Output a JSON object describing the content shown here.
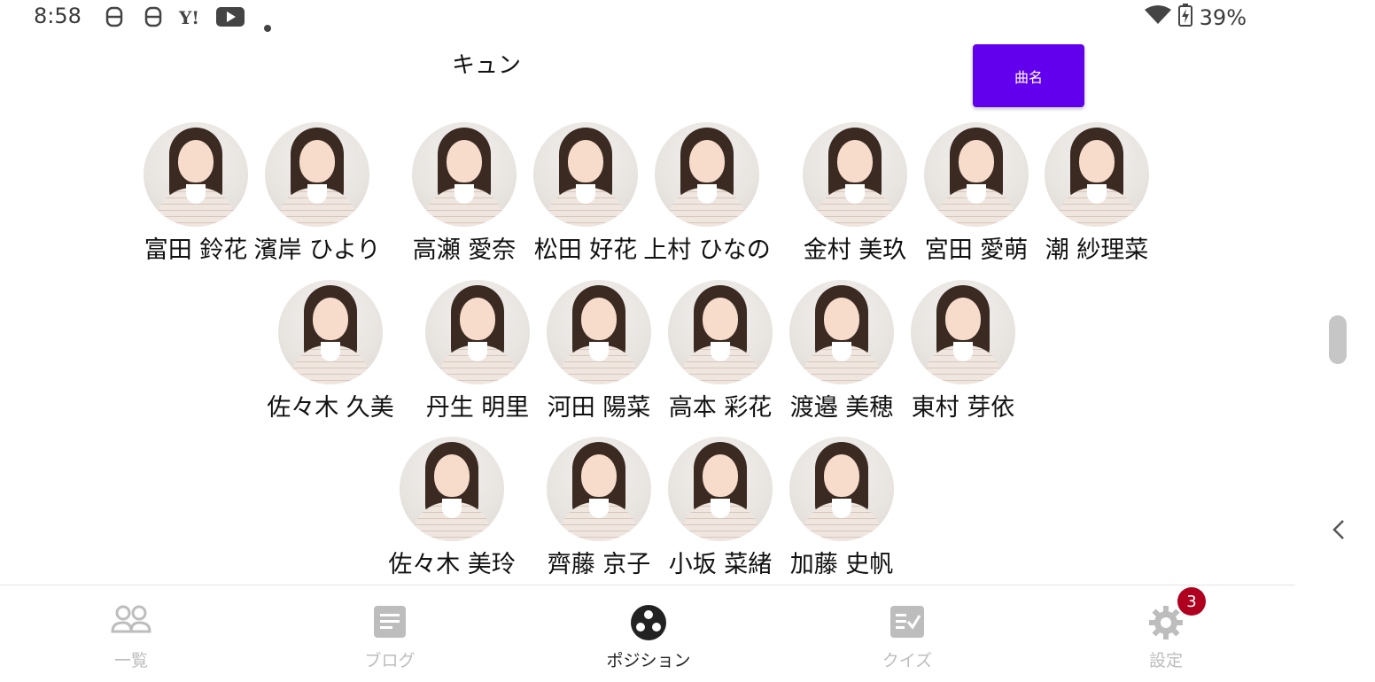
{
  "status_bar": {
    "time": "8:58",
    "battery": "39%"
  },
  "song": {
    "title": "キュン",
    "button_label": "曲名",
    "accent_color": "#6200ee"
  },
  "formation": {
    "rows": [
      {
        "members": [
          "富田 鈴花",
          "濱岸 ひより",
          "高瀬 愛奈",
          "松田 好花",
          "上村 ひなの",
          "金村 美玖",
          "宮田 愛萌",
          "潮 紗理菜"
        ]
      },
      {
        "members": [
          "佐々木 久美",
          "丹生 明里",
          "河田 陽菜",
          "高本 彩花",
          "渡邉 美穂",
          "東村 芽依"
        ]
      },
      {
        "members": [
          "佐々木 美玲",
          "齊藤 京子",
          "小坂 菜緒",
          "加藤 史帆"
        ]
      }
    ]
  },
  "bottom_nav": {
    "items": [
      {
        "label": "一覧",
        "icon": "people-icon",
        "active": false
      },
      {
        "label": "ブログ",
        "icon": "article-icon",
        "active": false
      },
      {
        "label": "ポジション",
        "icon": "position-icon",
        "active": true
      },
      {
        "label": "クイズ",
        "icon": "quiz-icon",
        "active": false
      },
      {
        "label": "設定",
        "icon": "gear-icon",
        "active": false,
        "badge": "3"
      }
    ]
  }
}
